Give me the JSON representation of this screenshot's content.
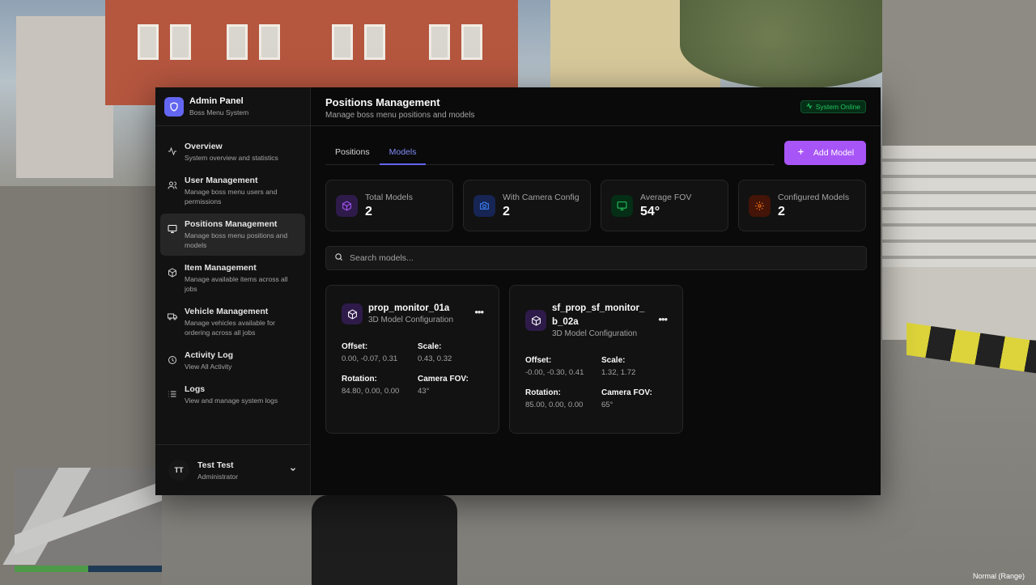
{
  "sidebar": {
    "brand_title": "Admin Panel",
    "brand_subtitle": "Boss Menu System",
    "items": [
      {
        "title": "Overview",
        "desc": "System overview and statistics",
        "icon": "activity-icon"
      },
      {
        "title": "User Management",
        "desc": "Manage boss menu users and permissions",
        "icon": "users-icon"
      },
      {
        "title": "Positions Management",
        "desc": "Manage boss menu positions and models",
        "icon": "monitor-icon",
        "active": true
      },
      {
        "title": "Item Management",
        "desc": "Manage available items across all jobs",
        "icon": "package-icon"
      },
      {
        "title": "Vehicle Management",
        "desc": "Manage vehicles available for ordering across all jobs",
        "icon": "truck-icon"
      },
      {
        "title": "Activity Log",
        "desc": "View All Activity",
        "icon": "clock-icon"
      },
      {
        "title": "Logs",
        "desc": "View and manage system logs",
        "icon": "list-icon"
      }
    ],
    "user": {
      "initials": "TT",
      "name": "Test Test",
      "role": "Administrator"
    }
  },
  "header": {
    "title": "Positions Management",
    "subtitle": "Manage boss menu positions and models",
    "status": "System Online"
  },
  "tabs": [
    {
      "label": "Positions",
      "active": false
    },
    {
      "label": "Models",
      "active": true
    }
  ],
  "add_button": "Add Model",
  "stats": [
    {
      "label": "Total Models",
      "value": "2",
      "color": "#a855f7"
    },
    {
      "label": "With Camera Config",
      "value": "2",
      "color": "#3b82f6"
    },
    {
      "label": "Average FOV",
      "value": "54°",
      "color": "#22c55e"
    },
    {
      "label": "Configured Models",
      "value": "2",
      "color": "#f97316"
    }
  ],
  "search": {
    "placeholder": "Search models..."
  },
  "models": [
    {
      "name": "prop_monitor_01a",
      "subtitle": "3D Model Configuration",
      "offset_label": "Offset:",
      "offset": "0.00, -0.07, 0.31",
      "scale_label": "Scale:",
      "scale": "0.43, 0.32",
      "rotation_label": "Rotation:",
      "rotation": "84.80, 0.00, 0.00",
      "fov_label": "Camera FOV:",
      "fov": "43°"
    },
    {
      "name": "sf_prop_sf_monitor_b_02a",
      "subtitle": "3D Model Configuration",
      "offset_label": "Offset:",
      "offset": "-0.00, -0.30, 0.41",
      "scale_label": "Scale:",
      "scale": "1.32, 1.72",
      "rotation_label": "Rotation:",
      "rotation": "85.00, 0.00, 0.00",
      "fov_label": "Camera FOV:",
      "fov": "65°"
    }
  ],
  "hud": {
    "mode_text": "Normal (Range)"
  }
}
